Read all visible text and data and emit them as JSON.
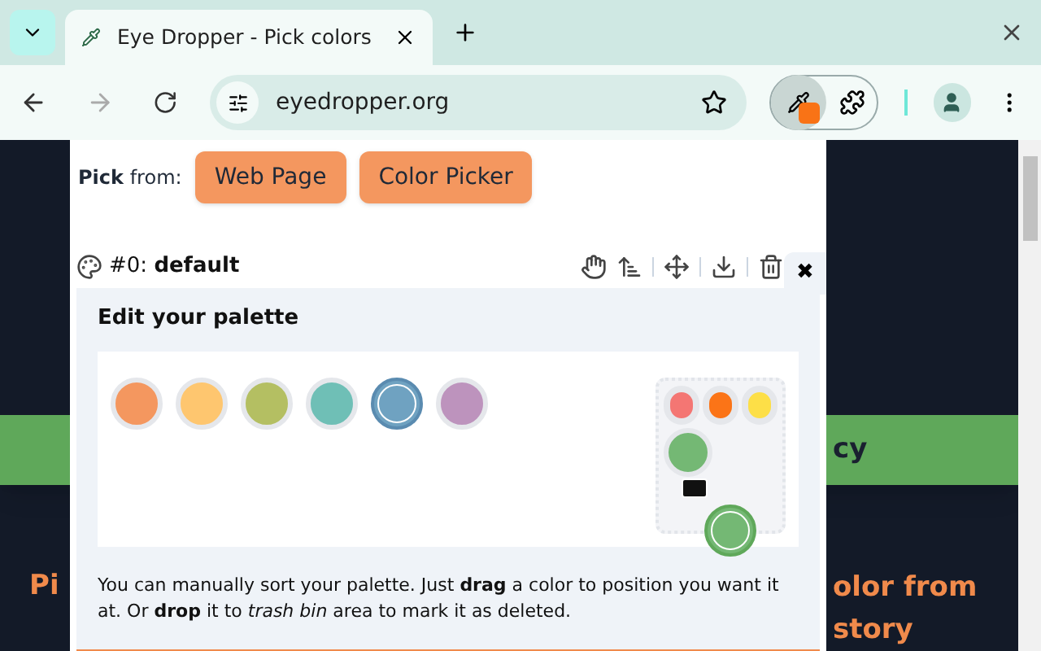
{
  "browser": {
    "tab_title": "Eye Dropper - Pick colors",
    "url": "eyedropper.org"
  },
  "page": {
    "banner_text": "cy",
    "heading_left": "Pi",
    "heading_right": [
      "olor from",
      "story"
    ]
  },
  "popup": {
    "pick_label": "**Pick** from:",
    "pick_buttons": [
      "Web Page",
      "Color Picker"
    ],
    "palette_title": "#0: **default**",
    "close_symbol": "✖",
    "edit_title": "Edit your palette",
    "colors": [
      {
        "color": "#f4975f",
        "selected": false
      },
      {
        "color": "#fec66f",
        "selected": false
      },
      {
        "color": "#b4bf62",
        "selected": false
      },
      {
        "color": "#6fbfb6",
        "selected": false
      },
      {
        "color": "#6fa2c1",
        "selected": true
      },
      {
        "color": "#bd93bd",
        "selected": false
      }
    ],
    "trash_colors": [
      {
        "color": "#f47673"
      },
      {
        "color": "#fb7417"
      },
      {
        "color": "#fddf47"
      },
      {
        "color": "#74b874"
      }
    ],
    "dragged_color": {
      "color": "#74b874"
    },
    "help_text": "You can manually sort your palette. Just **drag** a color to position you want it at. Or **drop** it to *trash bin* area to mark it as deleted."
  }
}
